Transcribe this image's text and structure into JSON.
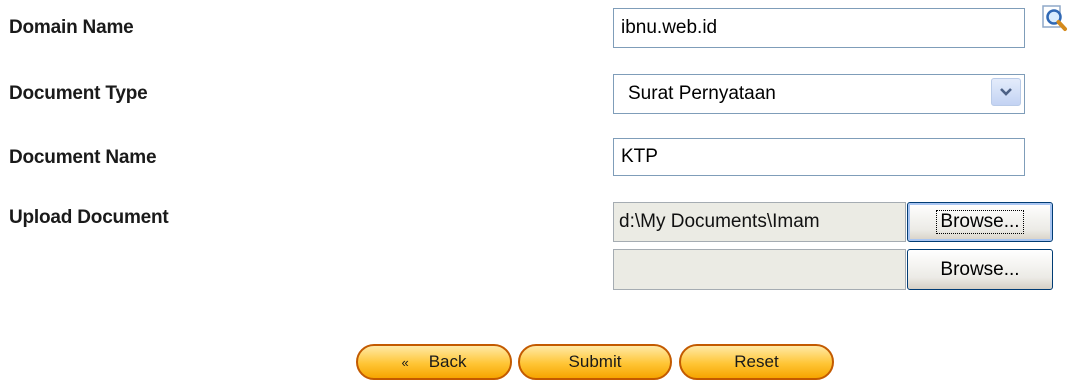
{
  "form": {
    "domain_name": {
      "label": "Domain Name",
      "value": "ibnu.web.id",
      "search_icon": "magnifier-document-icon"
    },
    "document_type": {
      "label": "Document Type",
      "selected": "Surat Pernyataan",
      "arrow_icon": "chevron-down-icon"
    },
    "document_name": {
      "label": "Document Name",
      "value": "KTP"
    },
    "upload_document": {
      "label": "Upload Document",
      "file1_value": "d:\\My Documents\\Imam",
      "file2_value": "",
      "browse_label": "Browse..."
    }
  },
  "actions": {
    "back_label": "Back",
    "back_icon": "«",
    "submit_label": "Submit",
    "reset_label": "Reset"
  },
  "colors": {
    "button_fill": "#ffc535",
    "button_border": "#c35a00",
    "input_border": "#7f9db9"
  }
}
